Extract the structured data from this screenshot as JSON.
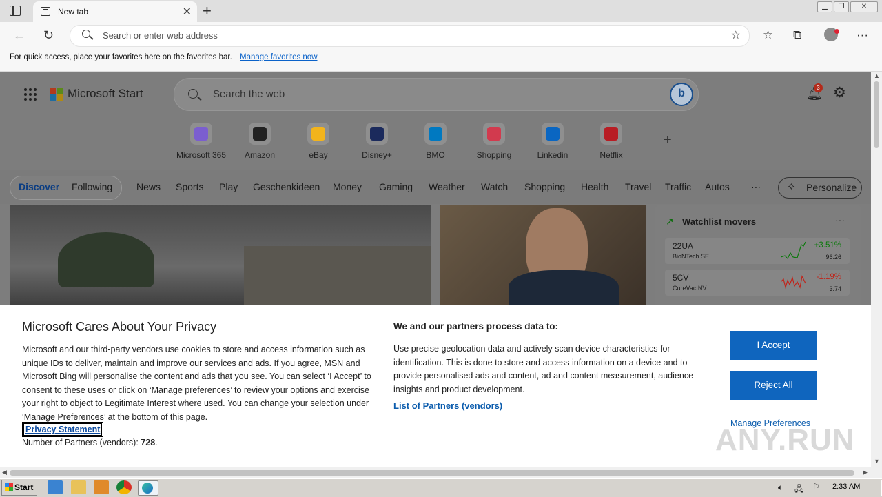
{
  "browser": {
    "tab_title": "New tab",
    "address_placeholder": "Search or enter web address",
    "favbar_text": "For quick access, place your favorites here on the favorites bar.",
    "favbar_link": "Manage favorites now"
  },
  "header": {
    "brand": "Microsoft Start",
    "search_placeholder": "Search the web",
    "notification_count": "3"
  },
  "quick_links": [
    {
      "label": "Microsoft 365",
      "color": "#7b5ecf"
    },
    {
      "label": "Amazon",
      "color": "#222222"
    },
    {
      "label": "eBay",
      "color": "#f3b41c"
    },
    {
      "label": "Disney+",
      "color": "#1b2a5c"
    },
    {
      "label": "BMO",
      "color": "#0079c1"
    },
    {
      "label": "Shopping",
      "color": "#d23a4e"
    },
    {
      "label": "Linkedin",
      "color": "#0a66c2"
    },
    {
      "label": "Netflix",
      "color": "#b81d24"
    }
  ],
  "nav": {
    "discover": "Discover",
    "following": "Following",
    "items": [
      "News",
      "Sports",
      "Play",
      "Geschenkideen",
      "Money",
      "Gaming",
      "Weather",
      "Watch",
      "Shopping",
      "Health",
      "Travel",
      "Traffic",
      "Autos"
    ],
    "more": "···",
    "personalize": "Personalize"
  },
  "watchlist": {
    "title": "Watchlist movers",
    "stocks": [
      {
        "symbol": "22UA",
        "name": "BioNTech SE",
        "change": "+3.51%",
        "price": "96.26",
        "color": "#0b7a0b"
      },
      {
        "symbol": "5CV",
        "name": "CureVac NV",
        "change": "-1.19%",
        "price": "3.74",
        "color": "#c0241a"
      }
    ]
  },
  "privacy": {
    "title": "Microsoft Cares About Your Privacy",
    "body": "Microsoft and our third-party vendors use cookies to store and access information such as unique IDs to deliver, maintain and improve our services and ads. If you agree, MSN and Microsoft Bing will personalise the content and ads that you see. You can select ‘I Accept’ to consent to these uses or click on ‘Manage preferences’ to review your options and exercise your right to object to Legitimate Interest where used.  You can change your selection under ‘Manage Preferences’ at the bottom of this page.",
    "statement_link": "Privacy Statement",
    "partners_label": "Number of Partners (vendors):",
    "partners_count": "728",
    "partners_suffix": ".",
    "process_title": "We and our partners process data to:",
    "process_body": "Use precise geolocation data and actively scan device characteristics for identification. This is done to store and access information on a device and to provide personalised ads and content, ad and content measurement, audience insights and product development.",
    "vendors_link": "List of Partners (vendors)",
    "accept": "I Accept",
    "reject": "Reject All",
    "manage": "Manage Preferences"
  },
  "watermark": "ANY.RUN",
  "taskbar": {
    "start": "Start",
    "clock": "2:33 AM"
  }
}
